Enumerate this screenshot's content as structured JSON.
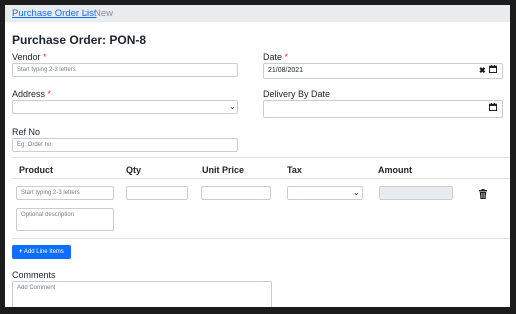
{
  "breadcrumb": {
    "parent": "Purchase Order List",
    "separator": ">",
    "current": "New"
  },
  "page_title": "Purchase Order: PON-8",
  "form": {
    "vendor": {
      "label": "Vendor",
      "required_mark": "*",
      "placeholder": "Start typing 2-3 letters"
    },
    "date": {
      "label": "Date",
      "required_mark": "*",
      "value": "21/08/2021"
    },
    "address": {
      "label": "Address",
      "required_mark": "*"
    },
    "delivery_by_date": {
      "label": "Delivery By Date",
      "value": ""
    },
    "ref_no": {
      "label": "Ref No",
      "placeholder": "Eg: Order no."
    }
  },
  "line_items": {
    "columns": [
      "Product",
      "Qty",
      "Unit Price",
      "Tax",
      "Amount"
    ],
    "row": {
      "product_placeholder": "Start typing 2-3 letters",
      "description_placeholder": "Optional description",
      "qty": "",
      "unit_price": "",
      "tax": "",
      "amount": ""
    },
    "add_button_label": "Add Line Items"
  },
  "comments": {
    "label": "Comments",
    "placeholder": "Add Comment"
  },
  "icons": [
    "clear-icon",
    "calendar-icon",
    "chevron-down-icon",
    "trash-icon",
    "plus-icon"
  ],
  "colors": {
    "link": "#0d6efd",
    "required": "#dc3545",
    "button": "#0d6efd",
    "breadcrumb_bg": "#e9ecef"
  }
}
